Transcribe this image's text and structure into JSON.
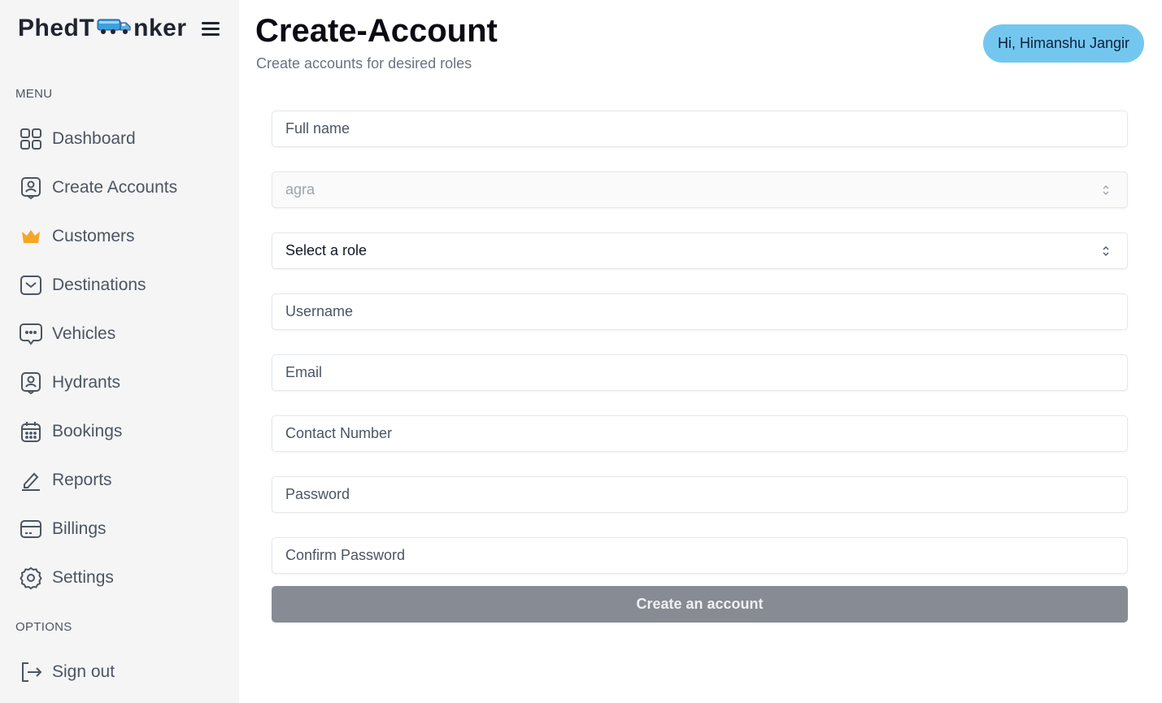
{
  "brand": {
    "name_prefix": "PhedT",
    "name_suffix": "nker",
    "accent": "#3b9fe0"
  },
  "sidebar": {
    "menu_label": "MENU",
    "options_label": "OPTIONS",
    "items": [
      {
        "label": "Dashboard",
        "icon": "grid-icon"
      },
      {
        "label": "Create Accounts",
        "icon": "user-badge-icon"
      },
      {
        "label": "Customers",
        "icon": "crown-icon"
      },
      {
        "label": "Destinations",
        "icon": "inbox-icon"
      },
      {
        "label": "Vehicles",
        "icon": "chat-bubble-icon"
      },
      {
        "label": "Hydrants",
        "icon": "user-badge-icon"
      },
      {
        "label": "Bookings",
        "icon": "calendar-icon"
      },
      {
        "label": "Reports",
        "icon": "pen-icon"
      },
      {
        "label": "Billings",
        "icon": "card-icon"
      },
      {
        "label": "Settings",
        "icon": "gear-icon"
      }
    ],
    "sign_out": {
      "label": "Sign out",
      "icon": "sign-out-icon"
    }
  },
  "header": {
    "title": "Create-Account",
    "subtitle": "Create accounts for desired roles",
    "greeting": "Hi, Himanshu Jangir",
    "greeting_color": "#73c7ef"
  },
  "form": {
    "full_name_placeholder": "Full name",
    "city_value": "agra",
    "role_value": "Select a role",
    "username_placeholder": "Username",
    "email_placeholder": "Email",
    "contact_placeholder": "Contact Number",
    "password_placeholder": "Password",
    "confirm_password_placeholder": "Confirm Password",
    "submit_label": "Create an account",
    "submit_color": "#878b94"
  },
  "colors": {
    "crown": "#f5a623",
    "sidebar_bg": "#f5f5f5"
  }
}
